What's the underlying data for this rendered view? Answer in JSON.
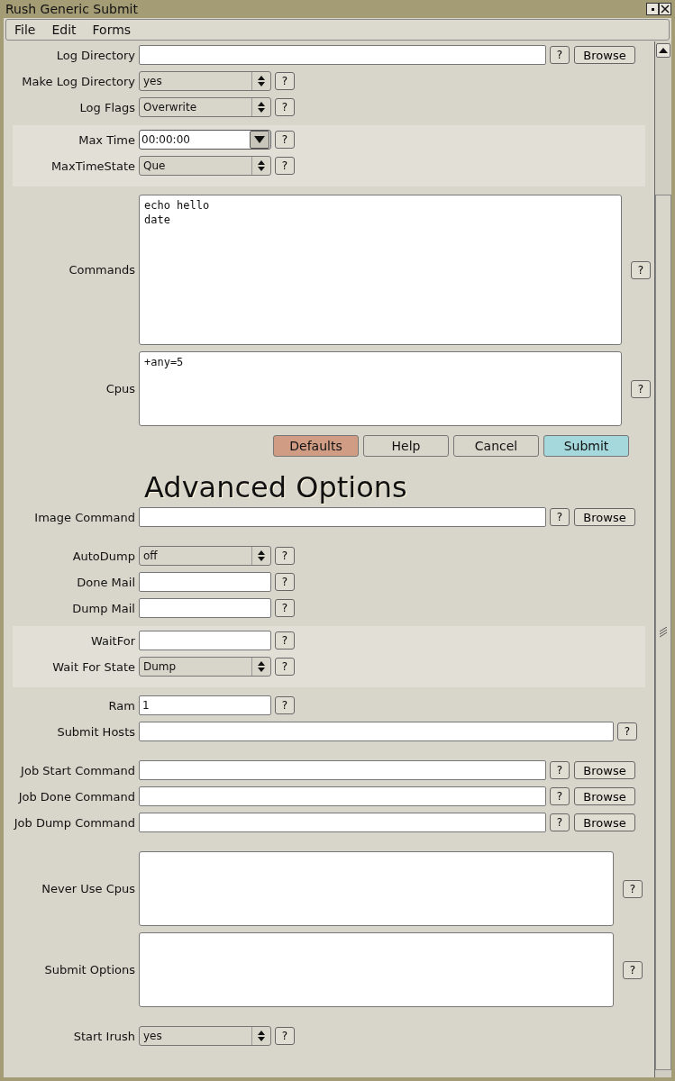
{
  "window": {
    "title": "Rush Generic Submit"
  },
  "menu": [
    "File",
    "Edit",
    "Forms"
  ],
  "sections": [
    {
      "kind": "fields",
      "rows": [
        {
          "kind": "path",
          "label": "Log Directory",
          "help": "?",
          "browse": "Browse"
        },
        {
          "kind": "select",
          "label": "Make Log Directory",
          "value": "yes",
          "help": "?"
        },
        {
          "kind": "select",
          "label": "Log Flags",
          "value": "Overwrite",
          "help": "?"
        }
      ]
    },
    {
      "kind": "group",
      "rows": [
        {
          "kind": "combo",
          "label": "Max Time",
          "value": "00:00:00",
          "help": "?"
        },
        {
          "kind": "select",
          "label": "MaxTimeState",
          "value": "Que",
          "help": "?"
        }
      ]
    },
    {
      "kind": "fields",
      "rows": [
        {
          "kind": "script",
          "label": "Commands",
          "value": "echo hello\ndate",
          "help": "?"
        },
        {
          "kind": "list",
          "label": "Cpus",
          "value": "+any=5",
          "help": "?"
        }
      ]
    },
    {
      "kind": "buttons",
      "buttons": [
        {
          "label": "Defaults",
          "color": "#d09c84"
        },
        {
          "label": "Help",
          "color": "#d8d5ca"
        },
        {
          "label": "Cancel",
          "color": "#d8d5ca"
        },
        {
          "label": "Submit",
          "color": "#a4d8dc"
        }
      ]
    },
    {
      "kind": "heading",
      "text": "Advanced Options"
    },
    {
      "kind": "fields",
      "rows": [
        {
          "kind": "path",
          "label": "Image Command",
          "help": "?",
          "browse": "Browse"
        }
      ]
    },
    {
      "kind": "fields",
      "rows": [
        {
          "kind": "select",
          "label": "AutoDump",
          "value": "off",
          "help": "?"
        },
        {
          "kind": "text",
          "label": "Done Mail",
          "help": "?"
        },
        {
          "kind": "text",
          "label": "Dump Mail",
          "help": "?"
        }
      ]
    },
    {
      "kind": "group",
      "rows": [
        {
          "kind": "text",
          "label": "WaitFor",
          "help": "?"
        },
        {
          "kind": "select",
          "label": "Wait For State",
          "value": "Dump",
          "help": "?"
        }
      ]
    },
    {
      "kind": "fields",
      "rows": [
        {
          "kind": "text",
          "label": "Ram",
          "value": "1",
          "help": "?"
        },
        {
          "kind": "long",
          "label": "Submit Hosts",
          "help": "?"
        }
      ]
    },
    {
      "kind": "fields",
      "rows": [
        {
          "kind": "path",
          "label": "Job Start Command",
          "help": "?",
          "browse": "Browse"
        },
        {
          "kind": "path",
          "label": "Job Done Command",
          "help": "?",
          "browse": "Browse"
        },
        {
          "kind": "path",
          "label": "Job Dump Command",
          "help": "?",
          "browse": "Browse"
        }
      ]
    },
    {
      "kind": "fields",
      "rows": [
        {
          "kind": "list-narrow",
          "label": "Never Use Cpus",
          "help": "?"
        },
        {
          "kind": "list-narrow",
          "label": "Submit Options",
          "help": "?"
        }
      ]
    },
    {
      "kind": "fields",
      "rows": [
        {
          "kind": "select",
          "label": "Start Irush",
          "value": "yes",
          "help": "?"
        }
      ]
    }
  ]
}
